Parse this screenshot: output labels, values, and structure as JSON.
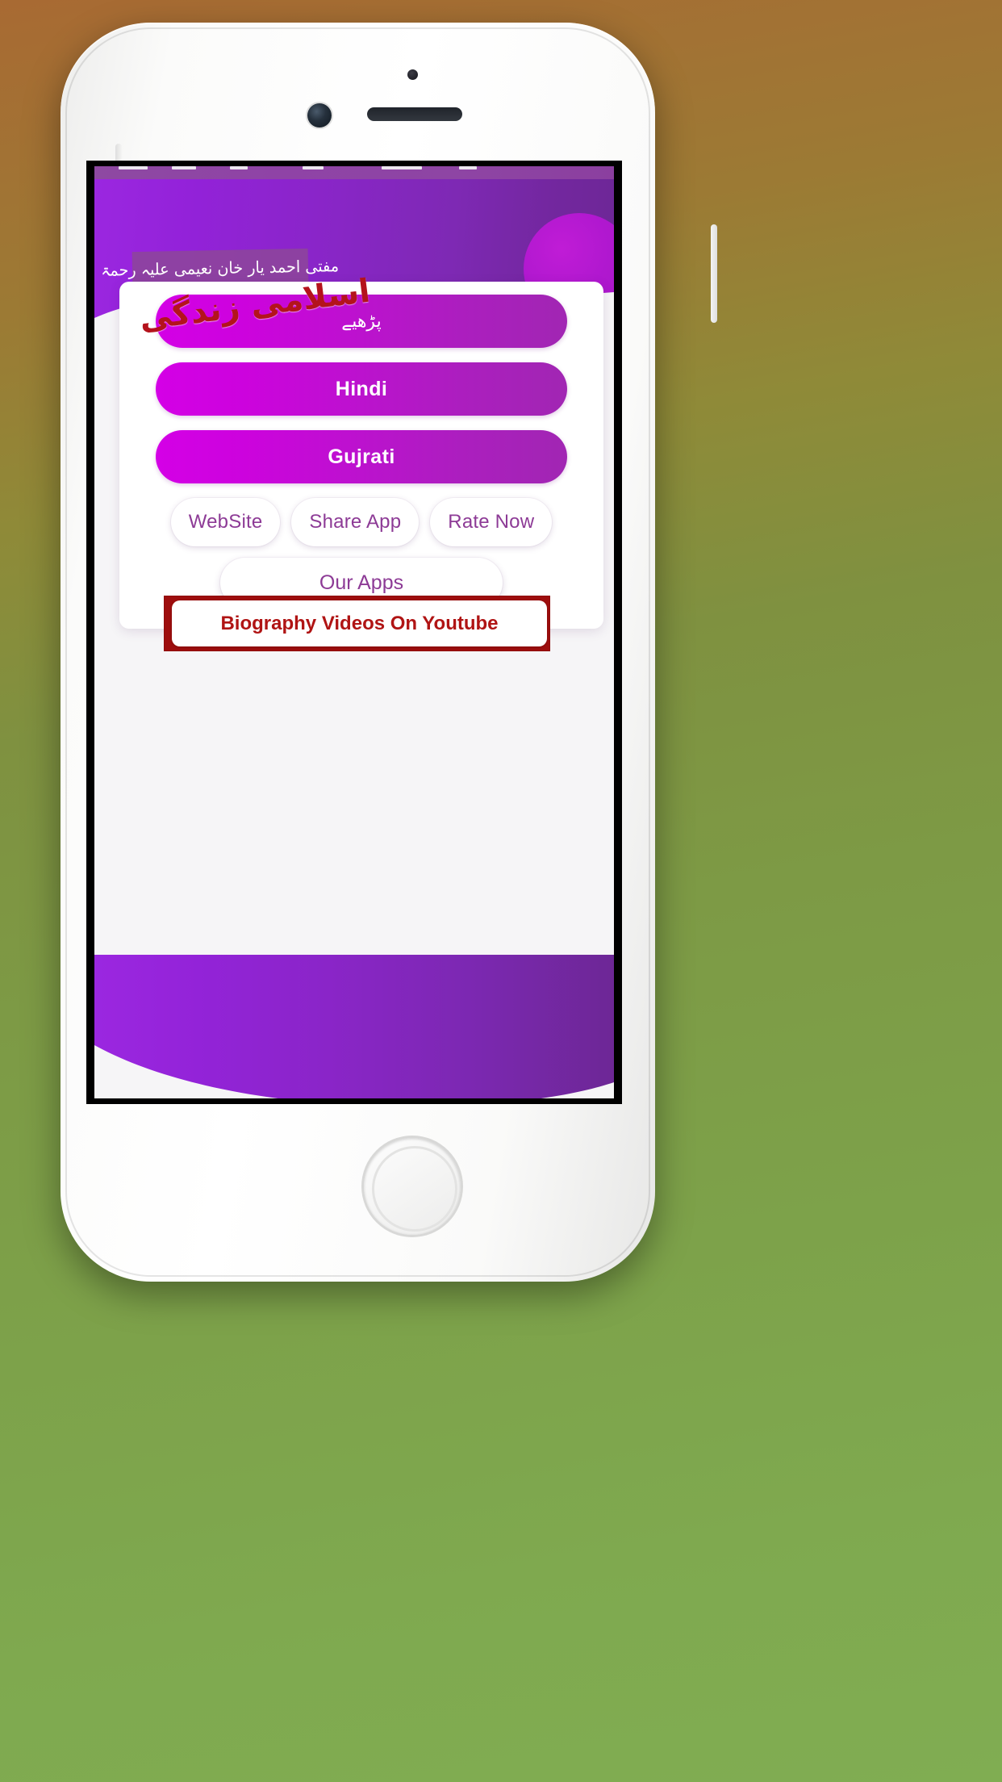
{
  "app": {
    "header_title_urdu": "مفتی احمد یار خان نعیمی علیہ رحمۃ",
    "wordmark_urdu": "اسلامی زندگی"
  },
  "menu": {
    "primary_buttons": [
      {
        "label": "پڑھیے",
        "name": "read-urdu-button",
        "script": "urdu"
      },
      {
        "label": "Hindi",
        "name": "hindi-button",
        "script": "latin"
      },
      {
        "label": "Gujrati",
        "name": "gujrati-button",
        "script": "latin"
      }
    ],
    "secondary_buttons": [
      {
        "label": "WebSite",
        "name": "website-button"
      },
      {
        "label": "Share App",
        "name": "share-app-button"
      },
      {
        "label": "Rate Now",
        "name": "rate-now-button"
      }
    ],
    "our_apps_label": "Our Apps"
  },
  "youtube": {
    "label": "Biography Videos On Youtube"
  },
  "colors": {
    "header_purple_light": "#9b27e0",
    "header_purple_dark": "#6d2796",
    "pill_magenta": "#d400e6",
    "pill_purple": "#a126b3",
    "text_purple": "#8d3b96",
    "youtube_red": "#9e0e0e",
    "wordmark_red": "#b4131c",
    "status_strip": "#8e45a4"
  },
  "icons": {
    "phone_camera": "front-camera-icon",
    "phone_sensor": "proximity-sensor-icon",
    "phone_speaker": "earpiece-speaker-icon",
    "phone_home": "home-button-icon"
  }
}
